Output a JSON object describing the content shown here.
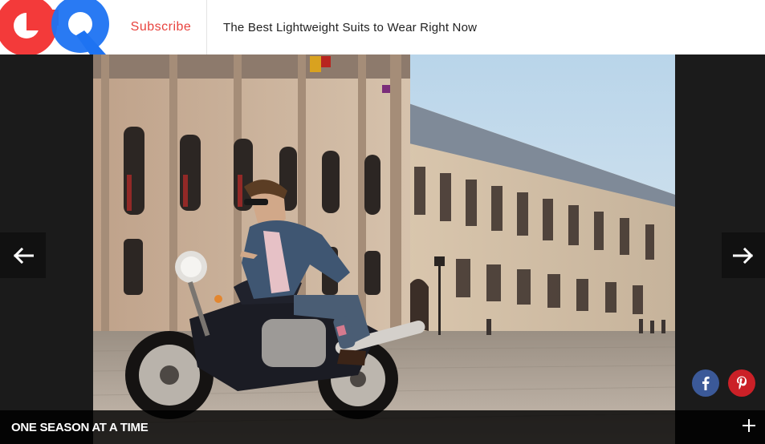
{
  "header": {
    "logo_text": "GQ",
    "subscribe_label": "Subscribe",
    "headline": "The Best Lightweight Suits to Wear Right Now"
  },
  "gallery": {
    "caption_title": "ONE SEASON AT A TIME",
    "prev_icon": "arrow-left-icon",
    "next_icon": "arrow-right-icon",
    "expand_icon": "plus-icon"
  },
  "share": {
    "facebook_icon": "facebook-icon",
    "pinterest_icon": "pinterest-icon"
  },
  "colors": {
    "subscribe": "#e8433e",
    "logo_red": "#f33a3a",
    "logo_blue": "#1e73f2",
    "facebook": "#3b5998",
    "pinterest": "#cb2027"
  }
}
